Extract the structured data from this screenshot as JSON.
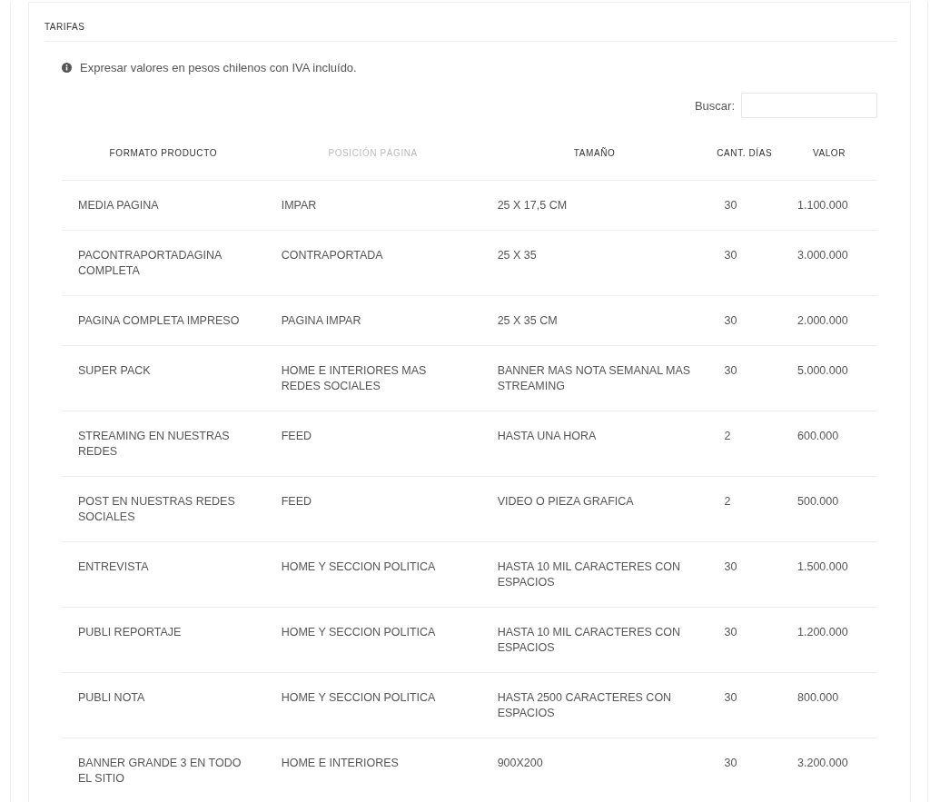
{
  "card": {
    "title": "TARIFAS"
  },
  "notice": "Expresar valores en pesos chilenos con IVA incluído.",
  "search": {
    "label": "Buscar:"
  },
  "table": {
    "columns": [
      {
        "label": "FORMATO PRODUCTO",
        "dimmed": false
      },
      {
        "label": "POSICIÓN PÁGINA",
        "dimmed": true
      },
      {
        "label": "TAMAÑO",
        "dimmed": false
      },
      {
        "label": "CANT. DÍAS",
        "dimmed": false
      },
      {
        "label": "VALOR",
        "dimmed": false
      }
    ],
    "rows": [
      [
        "MEDIA PAGINA",
        "IMPAR",
        "25 X 17,5 CM",
        "30",
        "1.100.000"
      ],
      [
        "PACONTRAPORTADAGINA COMPLETA",
        "CONTRAPORTADA",
        "25 X 35",
        "30",
        "3.000.000"
      ],
      [
        "PAGINA COMPLETA IMPRESO",
        "PAGINA IMPAR",
        "25 X 35 CM",
        "30",
        "2.000.000"
      ],
      [
        "SUPER PACK",
        "HOME E INTERIORES MAS REDES SOCIALES",
        "BANNER MAS NOTA SEMANAL MAS STREAMING",
        "30",
        "5.000.000"
      ],
      [
        "STREAMING EN NUESTRAS REDES",
        "FEED",
        "HASTA UNA HORA",
        "2",
        "600.000"
      ],
      [
        "POST EN NUESTRAS REDES SOCIALES",
        "FEED",
        "VIDEO O PIEZA GRAFICA",
        "2",
        "500.000"
      ],
      [
        "ENTREVISTA",
        "HOME Y SECCION POLITICA",
        "HASTA 10 MIL CARACTERES CON ESPACIOS",
        "30",
        "1.500.000"
      ],
      [
        "PUBLI REPORTAJE",
        "HOME Y SECCION POLITICA",
        "HASTA 10 MIL CARACTERES CON ESPACIOS",
        "30",
        "1.200.000"
      ],
      [
        "PUBLI NOTA",
        "HOME Y SECCION POLITICA",
        "HASTA 2500 CARACTERES CON ESPACIOS",
        "30",
        "800.000"
      ],
      [
        "BANNER GRANDE 3 EN TODO EL SITIO",
        "HOME E INTERIORES",
        "900X200",
        "30",
        "3.200.000"
      ]
    ]
  }
}
